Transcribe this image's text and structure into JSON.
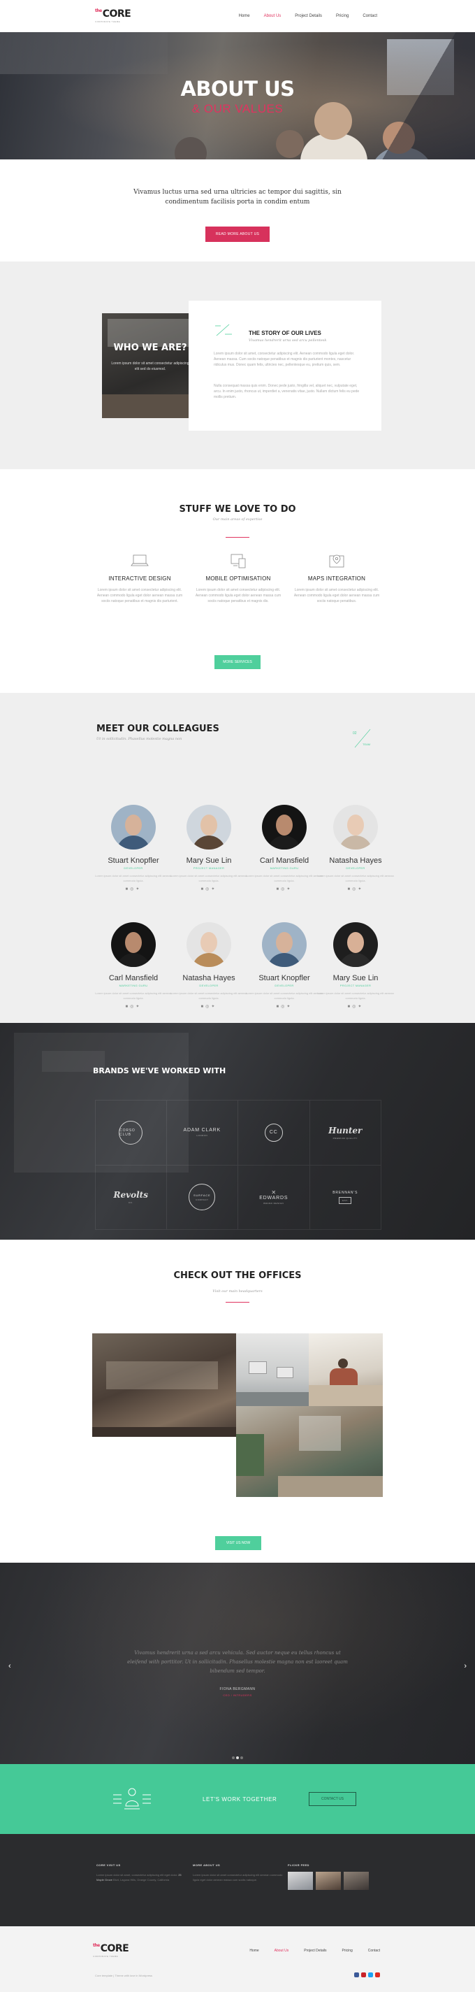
{
  "brand": {
    "logo": "CORE",
    "logo_sup": "the",
    "tagline": "CORPORATE THEME"
  },
  "nav": {
    "items": [
      "Home",
      "About Us",
      "Project Details",
      "Pricing",
      "Contact"
    ],
    "active": "About Us"
  },
  "hero": {
    "title": "ABOUT US",
    "subtitle": "& OUR VALUES"
  },
  "intro": {
    "text": "Vivamus luctus urna sed urna ultricies ac tempor dui sagittis, sin condimentum facilisis porta in condim entum",
    "button": "READ MORE ABOUT US"
  },
  "who": {
    "title": "WHO WE ARE?",
    "text": "Lorem ipsum dolor sit amet consectetur adipiscing elit sed do eiusmod.",
    "story_title": "THE STORY OF OUR LIVES",
    "story_subtitle": "Vivamus hendrerit urna sed arcu pellentesk",
    "story_p1": "Lorem ipsum dolor sit amet, consectetur adipiscing elit. Aenean commodo ligula eget dolor. Aenean massa. Cum sociis natoque penatibus et magnis dis parturient montes, nascetur ridiculus mus. Donec quam felis, ultricies nec, pellentesque eu, pretium quis, sem.",
    "story_p2": "Nulla consequat massa quis enim. Donec pede justo, fringilla vel, aliquet nec, vulputate eget, arcu. In enim justo, rhoncus ut, imperdiet a, venenatis vitae, justo. Nullam dictum felis eu pede mollis pretium."
  },
  "stuff": {
    "title": "STUFF WE LOVE TO DO",
    "subtitle": "Our main areas of expertise",
    "features": [
      {
        "icon": "laptop-icon",
        "title": "INTERACTIVE DESIGN",
        "text": "Lorem ipsum dolor sit amet consectetur adipiscing elit. Aenean commodo ligula eget dolor aenean massa cum sociis natoque penatibus et magnis dis parturient."
      },
      {
        "icon": "devices-icon",
        "title": "MOBILE OPTIMISATION",
        "text": "Lorem ipsum dolor sit amet consectetur adipiscing elit. Aenean commodo ligula eget dolor aenean massa cum sociis natoque penatibus et magnis dis."
      },
      {
        "icon": "map-pin-icon",
        "title": "MAPS INTEGRATION",
        "text": "Lorem ipsum dolor sit amet consectetur adipiscing elit. Aenean commodo ligula eget dolor aenean massa cum sociis natoque penatibus."
      }
    ],
    "button": "MORE SERVICES"
  },
  "team": {
    "title": "MEET OUR COLLEAGUES",
    "subtitle": "Ut in sollicitudin. Phasellus molestie magna non",
    "deco_top": "02",
    "deco_bottom": "TEAM",
    "members": [
      {
        "name": "Stuart Knopfler",
        "role": "DEVELOPER",
        "bio": "Lorem ipsum dolor sit amet consectetur adipiscing elit aenean commodo ligula.",
        "skin": "#d6b29a",
        "cloth": "#3f5b7a",
        "bg": "#9fb3c6"
      },
      {
        "name": "Mary Sue Lin",
        "role": "PROJECT MANAGER",
        "bio": "Lorem ipsum dolor sit amet consectetur adipiscing elit aenean commodo ligula.",
        "skin": "#e2c2a8",
        "cloth": "#5a4636",
        "bg": "#cfd6dd"
      },
      {
        "name": "Carl Mansfield",
        "role": "MARKETING GURU",
        "bio": "Lorem ipsum dolor sit amet consectetur adipiscing elit aenean commodo ligula.",
        "skin": "#b88a6e",
        "cloth": "#1c1c1c",
        "bg": "#141414"
      },
      {
        "name": "Natasha Hayes",
        "role": "DEVELOPER",
        "bio": "Lorem ipsum dolor sit amet consectetur adipiscing elit aenean commodo ligula.",
        "skin": "#e8cbb5",
        "cloth": "#c9b8a6",
        "bg": "#e4e4e4"
      },
      {
        "name": "Carl Mansfield",
        "role": "MARKETING GURU",
        "bio": "Lorem ipsum dolor sit amet consectetur adipiscing elit aenean commodo ligula.",
        "skin": "#b88a6e",
        "cloth": "#1c1c1c",
        "bg": "#141414"
      },
      {
        "name": "Natasha Hayes",
        "role": "DEVELOPER",
        "bio": "Lorem ipsum dolor sit amet consectetur adipiscing elit aenean commodo ligula.",
        "skin": "#e8cbb5",
        "cloth": "#b98c5a",
        "bg": "#e4e4e4"
      },
      {
        "name": "Stuart Knopfler",
        "role": "DEVELOPER",
        "bio": "Lorem ipsum dolor sit amet consectetur adipiscing elit aenean commodo ligula.",
        "skin": "#d6b29a",
        "cloth": "#3f5b7a",
        "bg": "#9fb3c6"
      },
      {
        "name": "Mary Sue Lin",
        "role": "PROJECT MANAGER",
        "bio": "Lorem ipsum dolor sit amet consectetur adipiscing elit aenean commodo ligula.",
        "skin": "#d8b096",
        "cloth": "#2a2a2a",
        "bg": "#1e1e1e"
      }
    ],
    "social_icons": [
      "facebook-icon",
      "pinterest-icon",
      "twitter-icon"
    ]
  },
  "brands": {
    "title": "BRANDS WE'VE WORKED WITH",
    "logos": [
      {
        "name": "CORSO CLUB",
        "sub": "",
        "style": "ring"
      },
      {
        "name": "ADAM CLARK",
        "sub": "LONDON",
        "style": "plain"
      },
      {
        "name": "CC",
        "sub": "",
        "style": "ring"
      },
      {
        "name": "Hunter",
        "sub": "PREMIUM QUALITY",
        "style": "script"
      },
      {
        "name": "Revolts",
        "sub": "CO.",
        "style": "script"
      },
      {
        "name": "SURFACE",
        "sub": "COMPANY",
        "style": "ring"
      },
      {
        "name": "EDWARDS",
        "sub": "BRAND DESIGN",
        "style": "plain"
      },
      {
        "name": "BRENNAN'S",
        "sub": "EST.",
        "style": "plain"
      }
    ]
  },
  "offices": {
    "title": "CHECK OUT THE OFFICES",
    "subtitle": "Visit our main headquarters",
    "button": "VISIT US NOW"
  },
  "testimonial": {
    "quote": "Vivamus hendrerit urna a sed arcu vehicula. Sed auctor neque eu tellus rhoncus ut eleifend with porttitor. Ut in sollicitudin. Phasellus molestie magna non est laoreet quam bibendum sed tempor.",
    "name": "FIONA BERGMANN",
    "company": "CEO / INTRUDERS",
    "dots": 3,
    "active_dot": 1
  },
  "cta": {
    "label": "LET'S WORK TOGETHER",
    "button": "CONTACT US"
  },
  "footer": {
    "col1_title": "CORE VISIT US",
    "col1_text": "Lorem ipsum dolor sit amet, consectetur adipiscing elit eget dolor.",
    "col1_addr": "25 Maple Grove",
    "col1_addr2": "Blvd, Laguna Hills, Orange County, California",
    "col2_title": "MORE ABOUT US",
    "col2_text": "Lorem ipsum dolor sit amet consectetur adipiscing elit aenean commodo ligula eget dolor aenean massa cum sociis natoque.",
    "col3_title": "FLICKR FEED",
    "copyright": "Core template | Theme with love in Wordpress"
  },
  "colors": {
    "accent_red": "#e0335f",
    "accent_green": "#4fcf9c",
    "dark": "#2b2c2e"
  }
}
